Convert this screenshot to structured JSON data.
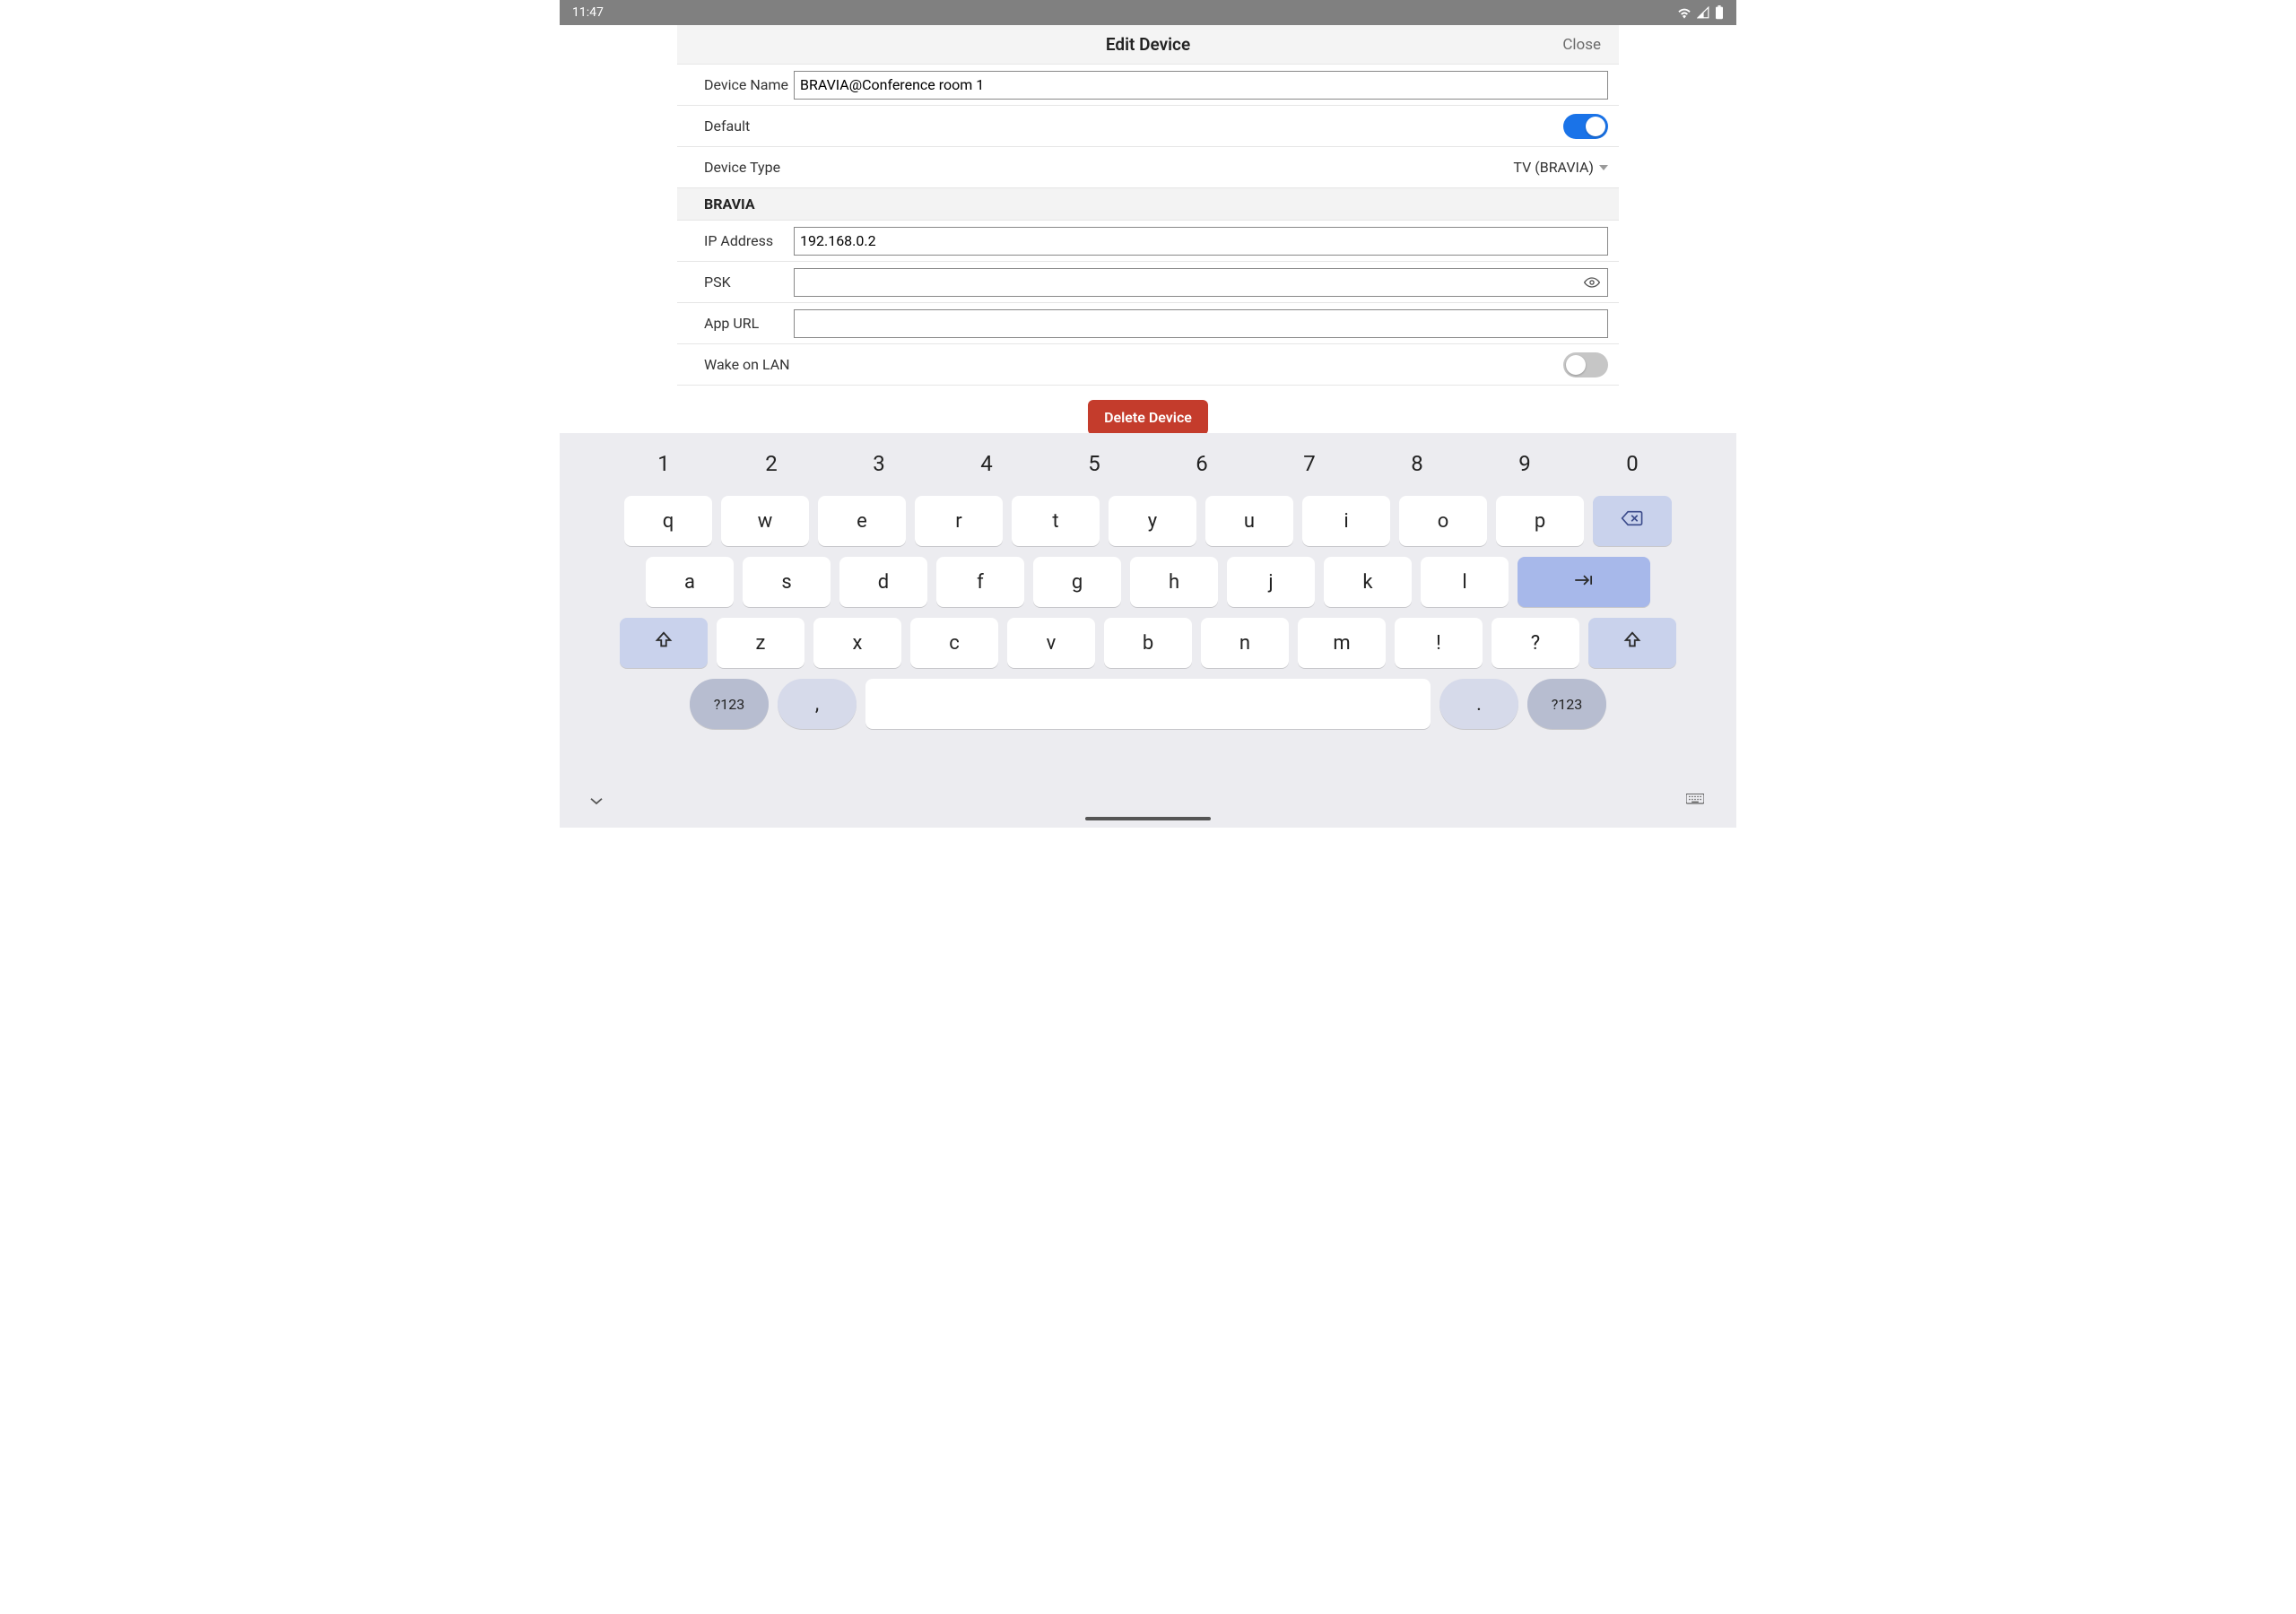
{
  "statusbar": {
    "time": "11:47"
  },
  "header": {
    "title": "Edit Device",
    "close": "Close"
  },
  "labels": {
    "device_name": "Device Name",
    "default": "Default",
    "device_type": "Device Type",
    "ip_address": "IP Address",
    "psk": "PSK",
    "app_url": "App URL",
    "wake_on_lan": "Wake on LAN"
  },
  "section": {
    "bravia": "BRAVIA"
  },
  "fields": {
    "device_name": "BRAVIA@Conference room 1",
    "device_type": "TV (BRAVIA)",
    "ip_address": "192.168.0.2",
    "psk": "",
    "app_url": ""
  },
  "toggles": {
    "default": true,
    "wake_on_lan": false
  },
  "buttons": {
    "delete": "Delete Device"
  },
  "keyboard": {
    "nums": [
      "1",
      "2",
      "3",
      "4",
      "5",
      "6",
      "7",
      "8",
      "9",
      "0"
    ],
    "row1": [
      "q",
      "w",
      "e",
      "r",
      "t",
      "y",
      "u",
      "i",
      "o",
      "p"
    ],
    "row2": [
      "a",
      "s",
      "d",
      "f",
      "g",
      "h",
      "j",
      "k",
      "l"
    ],
    "row3": [
      "z",
      "x",
      "c",
      "v",
      "b",
      "n",
      "m",
      "!",
      "?"
    ],
    "sym": "?123",
    "comma": ",",
    "period": "."
  }
}
